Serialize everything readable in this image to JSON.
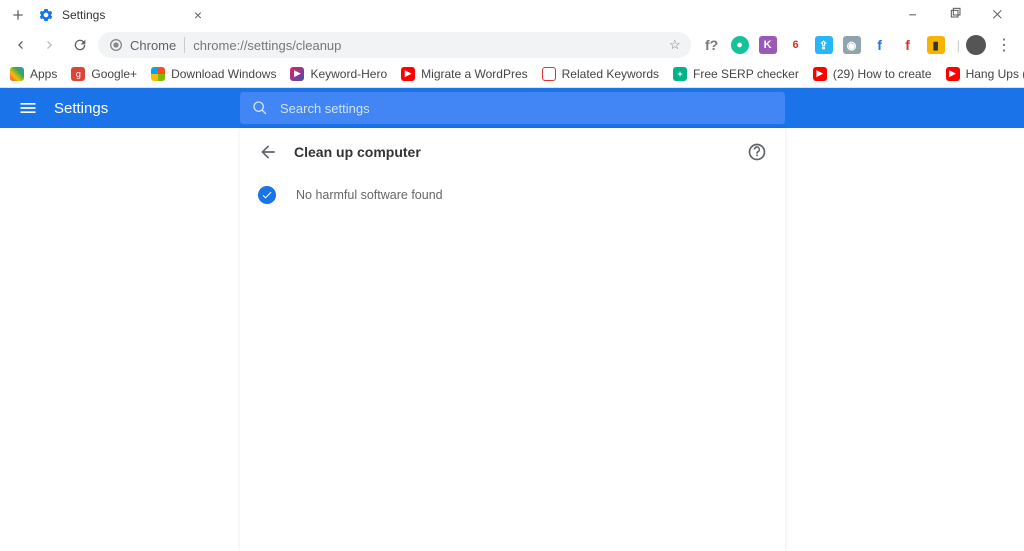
{
  "tab": {
    "title": "Settings"
  },
  "address": {
    "scheme_label": "Chrome",
    "url": "chrome://settings/cleanup"
  },
  "bookmarks": {
    "items": [
      {
        "label": "Apps",
        "color": "linear-gradient(45deg,#ea4335,#fbbc05,#34a853,#4285f4)"
      },
      {
        "label": "Google+",
        "color": "#db4437"
      },
      {
        "label": "Download Windows",
        "color": "ms"
      },
      {
        "label": "Keyword-Hero",
        "color": "kh"
      },
      {
        "label": "Migrate a WordPres",
        "color": "#ff0000"
      },
      {
        "label": "Related Keywords",
        "color": "#e8e8e8"
      },
      {
        "label": "Free SERP checker",
        "color": "#00b388"
      },
      {
        "label": "(29) How to create",
        "color": "#ff0000"
      },
      {
        "label": "Hang Ups (Want Yo",
        "color": "#ff0000"
      }
    ]
  },
  "extensions": {
    "items": [
      {
        "name": "question-icon",
        "bg": "transparent",
        "fg": "#777",
        "txt": "f?"
      },
      {
        "name": "grammarly-icon",
        "bg": "#15c39a",
        "fg": "#fff",
        "txt": "●"
      },
      {
        "name": "k-ext-icon",
        "bg": "#9b59b6",
        "fg": "#fff",
        "txt": "K"
      },
      {
        "name": "badge6-icon",
        "bg": "#fff",
        "fg": "#d93025",
        "txt": "6"
      },
      {
        "name": "share-icon",
        "bg": "#29b6f6",
        "fg": "#fff",
        "txt": "⇪"
      },
      {
        "name": "camera-icon",
        "bg": "#90a4ae",
        "fg": "#fff",
        "txt": "◉"
      },
      {
        "name": "f-blue-icon",
        "bg": "transparent",
        "fg": "#1877f2",
        "txt": "f"
      },
      {
        "name": "f-red-icon",
        "bg": "transparent",
        "fg": "#d93025",
        "txt": "f"
      },
      {
        "name": "flag-icon",
        "bg": "#f4b400",
        "fg": "#333",
        "txt": "▮"
      }
    ]
  },
  "settings": {
    "app_title": "Settings",
    "search_placeholder": "Search settings",
    "panel_title": "Clean up computer",
    "status_text": "No harmful software found"
  }
}
